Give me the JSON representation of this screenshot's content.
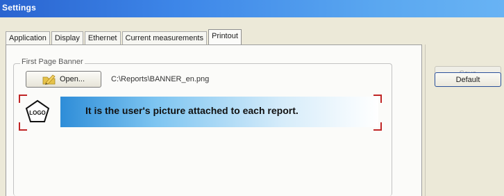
{
  "window": {
    "title": "Settings"
  },
  "tabs": [
    {
      "label": "Application",
      "active": false
    },
    {
      "label": "Display",
      "active": false
    },
    {
      "label": "Ethernet",
      "active": false
    },
    {
      "label": "Current measurements",
      "active": false
    },
    {
      "label": "Printout",
      "active": true
    }
  ],
  "first_page_banner": {
    "group_label": "First Page Banner",
    "open_button_label": "Open...",
    "file_path": "C:\\Reports\\BANNER_en.png",
    "banner_logo_text": "LOGO",
    "banner_text": "It is the user's picture attached to each report."
  },
  "side_buttons": {
    "save_label": "Save",
    "save_enabled": false,
    "default_label": "Default"
  },
  "colors": {
    "titlebar": "#3d86e8",
    "banner_gradient_start": "#2e8dd8",
    "corner_marks": "#c02525"
  },
  "icons": {
    "open_button_icon": "pencil-folder-icon",
    "banner_logo": "pentagon-logo-icon"
  }
}
